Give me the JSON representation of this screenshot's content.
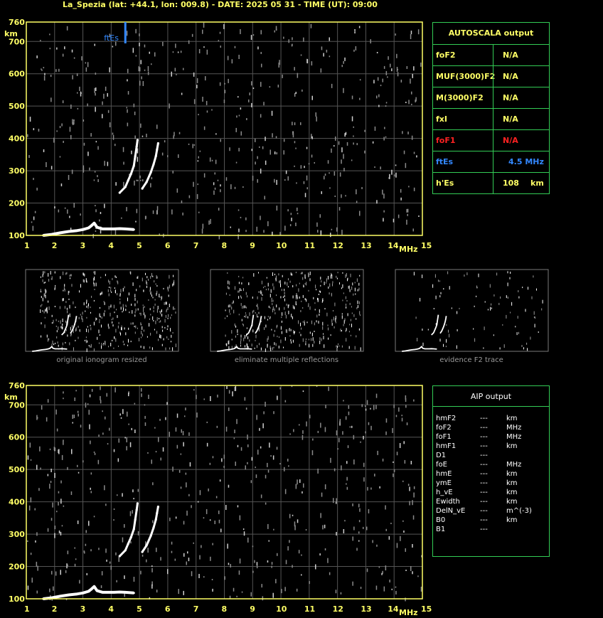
{
  "header": {
    "title": "La_Spezia (lat: +44.1, lon: 009.8) - DATE: 2025 05 31 - TIME (UT): 09:00"
  },
  "colors": {
    "axis": "#ffff66",
    "grid": "#555555",
    "trace": "#ffffff",
    "noise": "#8a8a8a",
    "panel_border": "#33cc55",
    "fEs_marker": "#3388ff",
    "foF1": "#ff2222"
  },
  "chart_data": [
    {
      "type": "scatter",
      "name_panel": "top-ionogram",
      "xlabel": "MHz",
      "ylabel": "km",
      "xlim": [
        1,
        15
      ],
      "ylim": [
        100,
        760
      ],
      "x_ticks": [
        "1",
        "2",
        "3",
        "4",
        "5",
        "6",
        "7",
        "8",
        "9",
        "10",
        "11",
        "12",
        "13",
        "14",
        "15"
      ],
      "y_ticks": [
        "100",
        "200",
        "300",
        "400",
        "500",
        "600",
        "700",
        "760"
      ],
      "grid": true,
      "marker_label": "ftEs",
      "marker_freq": 4.5,
      "traces": [
        {
          "x": [
            1.6,
            1.9,
            2.2,
            2.5,
            2.8,
            3.0,
            3.2,
            3.3,
            3.4,
            3.5,
            3.7,
            3.9,
            4.1,
            4.3,
            4.5,
            4.8
          ],
          "y": [
            100,
            103,
            108,
            112,
            115,
            118,
            123,
            130,
            138,
            125,
            120,
            120,
            120,
            121,
            120,
            118
          ]
        },
        {
          "x": [
            4.3,
            4.5,
            4.6,
            4.7,
            4.8,
            4.85,
            4.9,
            4.93
          ],
          "y": [
            232,
            250,
            270,
            290,
            315,
            345,
            375,
            395
          ]
        },
        {
          "x": [
            5.1,
            5.25,
            5.4,
            5.5,
            5.58,
            5.62,
            5.66
          ],
          "y": [
            245,
            265,
            295,
            320,
            345,
            365,
            385
          ]
        }
      ]
    },
    {
      "type": "scatter",
      "name_panel": "bottom-ionogram",
      "xlabel": "MHz",
      "ylabel": "km",
      "xlim": [
        1,
        15
      ],
      "ylim": [
        100,
        760
      ],
      "x_ticks": [
        "1",
        "2",
        "3",
        "4",
        "5",
        "6",
        "7",
        "8",
        "9",
        "10",
        "11",
        "12",
        "13",
        "14",
        "15"
      ],
      "y_ticks": [
        "100",
        "200",
        "300",
        "400",
        "500",
        "600",
        "700",
        "760"
      ],
      "grid": true,
      "traces": [
        {
          "x": [
            1.6,
            1.9,
            2.2,
            2.5,
            2.8,
            3.0,
            3.2,
            3.3,
            3.4,
            3.5,
            3.7,
            3.9,
            4.1,
            4.3,
            4.5,
            4.8
          ],
          "y": [
            100,
            103,
            108,
            112,
            115,
            118,
            123,
            130,
            138,
            125,
            120,
            120,
            120,
            121,
            120,
            118
          ]
        },
        {
          "x": [
            4.3,
            4.5,
            4.6,
            4.7,
            4.8,
            4.85,
            4.9,
            4.93
          ],
          "y": [
            232,
            250,
            270,
            290,
            315,
            345,
            375,
            395
          ]
        },
        {
          "x": [
            5.1,
            5.25,
            5.4,
            5.5,
            5.58,
            5.62,
            5.66
          ],
          "y": [
            245,
            265,
            295,
            320,
            345,
            365,
            385
          ]
        }
      ]
    }
  ],
  "thumbnails": [
    {
      "caption": "original ionogram resized"
    },
    {
      "caption": "eliminate multiple reflections"
    },
    {
      "caption": "evidence F2 trace"
    }
  ],
  "autoscala": {
    "title": "AUTOSCALA output",
    "rows": [
      {
        "key": "foF2",
        "value": "N/A"
      },
      {
        "key": "MUF(3000)F2",
        "value": "N/A"
      },
      {
        "key": "M(3000)F2",
        "value": "N/A"
      },
      {
        "key": "fxI",
        "value": "N/A"
      },
      {
        "key": "foF1",
        "value": "N/A"
      },
      {
        "key": "ftEs",
        "value": "4.5 MHz"
      },
      {
        "key": "h'Es",
        "value": "108",
        "unit": "km"
      }
    ]
  },
  "aip": {
    "title": "AIP output",
    "rows": [
      {
        "key": "hmF2",
        "value": "---",
        "unit": "km"
      },
      {
        "key": "foF2",
        "value": "---",
        "unit": "MHz"
      },
      {
        "key": "foF1",
        "value": "---",
        "unit": "MHz"
      },
      {
        "key": "hmF1",
        "value": "---",
        "unit": "km"
      },
      {
        "key": "D1",
        "value": "---",
        "unit": ""
      },
      {
        "key": "foE",
        "value": "---",
        "unit": "MHz"
      },
      {
        "key": "hmE",
        "value": "---",
        "unit": "km"
      },
      {
        "key": "ymE",
        "value": "---",
        "unit": "km"
      },
      {
        "key": "h_vE",
        "value": "---",
        "unit": "km"
      },
      {
        "key": "Ewidth",
        "value": "---",
        "unit": "km"
      },
      {
        "key": "DelN_vE",
        "value": "---",
        "unit": "m^(-3)"
      },
      {
        "key": "B0",
        "value": "---",
        "unit": "km"
      },
      {
        "key": "B1",
        "value": "---",
        "unit": ""
      }
    ]
  }
}
